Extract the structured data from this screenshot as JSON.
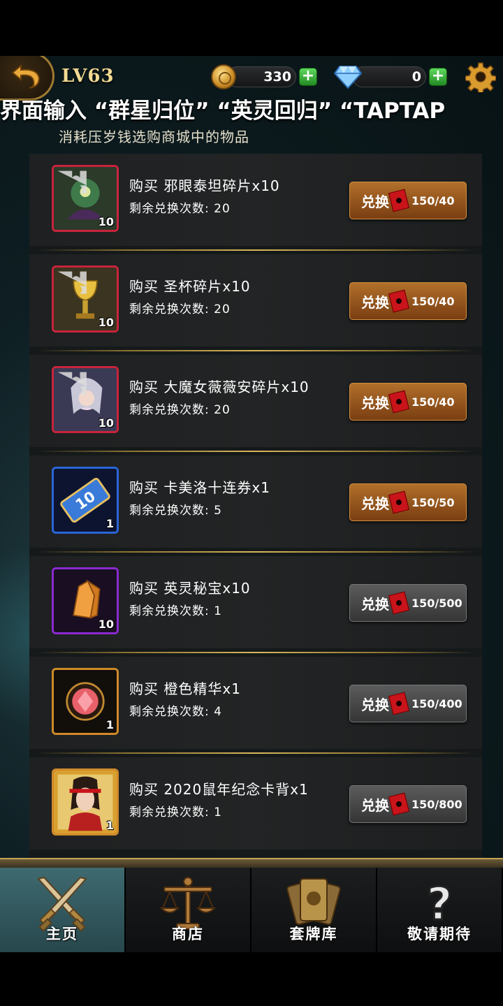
{
  "header": {
    "level": "LV63",
    "coins": "330",
    "gems": "0"
  },
  "marquee_text": "界面输入 “群星归位” “英灵回归” “TAPTAP",
  "subtitle": "消耗压岁钱选购商城中的物品",
  "items": [
    {
      "name": "购买 邪眼泰坦碎片x10",
      "remaining": "剩余兑换次数: 20",
      "qty": "10",
      "button": "兑换",
      "price": "150/40",
      "affordable": true,
      "icon": "titan-fragment-icon",
      "border_color": "#c8243c"
    },
    {
      "name": "购买 圣杯碎片x10",
      "remaining": "剩余兑换次数: 20",
      "qty": "10",
      "button": "兑换",
      "price": "150/40",
      "affordable": true,
      "icon": "grail-fragment-icon",
      "border_color": "#c8243c"
    },
    {
      "name": "购买 大魔女薇薇安碎片x10",
      "remaining": "剩余兑换次数: 20",
      "qty": "10",
      "button": "兑换",
      "price": "150/40",
      "affordable": true,
      "icon": "vivian-fragment-icon",
      "border_color": "#c8243c"
    },
    {
      "name": "购买 卡美洛十连券x1",
      "remaining": "剩余兑换次数: 5",
      "qty": "1",
      "button": "兑换",
      "price": "150/50",
      "affordable": true,
      "icon": "camelot-ticket-icon",
      "border_color": "#2a66d8"
    },
    {
      "name": "购买 英灵秘宝x10",
      "remaining": "剩余兑换次数: 1",
      "qty": "10",
      "button": "兑换",
      "price": "150/500",
      "affordable": false,
      "icon": "crystal-treasure-icon",
      "border_color": "#8a2ad0"
    },
    {
      "name": "购买 橙色精华x1",
      "remaining": "剩余兑换次数: 4",
      "qty": "1",
      "button": "兑换",
      "price": "150/400",
      "affordable": false,
      "icon": "orange-essence-icon",
      "border_color": "#d08a2a"
    },
    {
      "name": "购买 2020鼠年纪念卡背x1",
      "remaining": "剩余兑换次数: 1",
      "qty": "1",
      "button": "兑换",
      "price": "150/800",
      "affordable": false,
      "icon": "card-back-icon",
      "border_color": "#d08a2a"
    }
  ],
  "nav": [
    {
      "label": "主页",
      "active": true,
      "icon": "crossed-swords-icon"
    },
    {
      "label": "商店",
      "active": false,
      "icon": "scales-icon"
    },
    {
      "label": "套牌库",
      "active": false,
      "icon": "card-deck-icon"
    },
    {
      "label": "敬请期待",
      "active": false,
      "icon": "question-mark-icon"
    }
  ]
}
